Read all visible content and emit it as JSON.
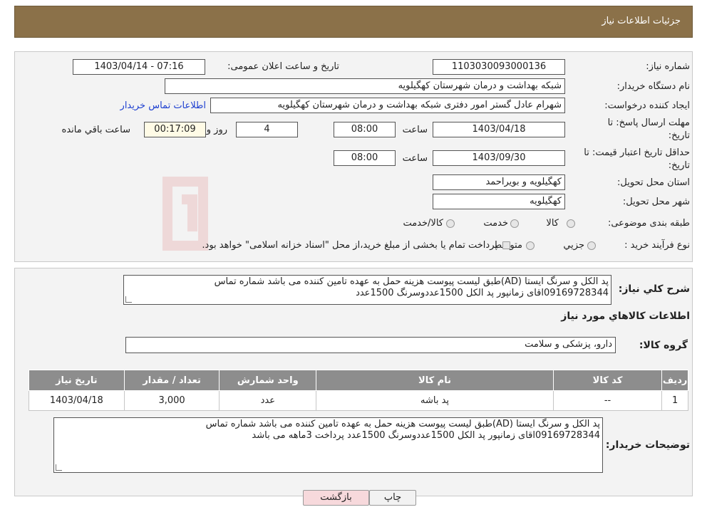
{
  "header": {
    "title": "جزئیات اطلاعات نیاز"
  },
  "fields": {
    "need_number_label": "شماره نیاز:",
    "need_number": "1103030093000136",
    "announce_label": "تاریخ و ساعت اعلان عمومی:",
    "announce_value": "1403/04/14 - 07:16",
    "buyer_org_label": "نام دستگاه خریدار:",
    "buyer_org": "شبکه بهداشت و درمان شهرستان کهگیلویه",
    "creator_label": "ایجاد کننده درخواست:",
    "creator": "شهرام عادل گستر امور دفتری شبکه بهداشت و درمان شهرستان کهگیلویه",
    "contact_link": "اطلاعات تماس خریدار",
    "deadline_label_1": "مهلت ارسال پاسخ: تا",
    "deadline_label_2": "تاریخ:",
    "deadline_date": "1403/04/18",
    "time_label": "ساعت",
    "deadline_time": "08:00",
    "days_value": "4",
    "days_label": "روز و",
    "remaining_time": "00:17:09",
    "remaining_label": "ساعت باقي مانده",
    "validity_label_1": "حداقل تاریخ اعتبار قیمت: تا",
    "validity_label_2": "تاریخ:",
    "validity_date": "1403/09/30",
    "validity_time": "08:00",
    "province_label": "استان محل تحویل:",
    "province": "کهگیلویه و بویراحمد",
    "city_label": "شهر محل تحویل:",
    "city": "کهگیلویه",
    "category_label": "طبقه بندی موضوعی:",
    "category_goods": "کالا",
    "category_service": "خدمت",
    "category_both": "کالا/خدمت",
    "process_label": "نوع فرآیند خرید :",
    "process_partial": "جزیي",
    "process_medium": "متوسط",
    "process_note": "پرداخت تمام یا بخشی از مبلغ خرید،از محل \"اسناد خزانه اسلامی\" خواهد بود."
  },
  "description": {
    "label": "شرح كلي نياز:",
    "line1": "پد الکل و سرنگ ایستا (AD)طبق لیست پیوست هزینه حمل به عهده تامین کننده می باشد شماره تماس",
    "line2": "09169728344اقای زمانپور      پد الکل 1500عددوسرنگ 1500عدد"
  },
  "goods_section": {
    "title": "اطلاعات كالاهاي مورد نياز",
    "group_label": "گروه کالا:",
    "group_value": "دارو، پزشکی و سلامت"
  },
  "table": {
    "headers": [
      "ردیف",
      "کد کالا",
      "نام کالا",
      "واحد شمارش",
      "تعداد / مقدار",
      "تاریخ نیاز"
    ],
    "rows": [
      [
        "1",
        "--",
        "پد باشه",
        "عدد",
        "3,000",
        "1403/04/18"
      ]
    ]
  },
  "buyer_notes": {
    "label": "توضیحات خریدار:",
    "line1": "پد الکل و سرنگ ایستا (AD)طبق لیست پیوست هزینه حمل به عهده تامین کننده می باشد شماره تماس",
    "line2": "09169728344اقای زمانپور      پد الکل 1500عددوسرنگ 1500عدد پرداخت 3ماهه می باشد"
  },
  "buttons": {
    "print": "چاپ",
    "back": "بازگشت"
  },
  "colors": {
    "header_bg": "#8b7149",
    "table_header_bg": "#8d8d8d",
    "link": "#1d3fd0",
    "back_button_bg": "#f7d9dc"
  }
}
